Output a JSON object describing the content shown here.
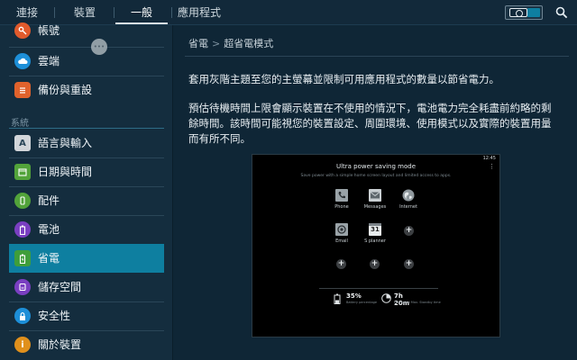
{
  "topbar": {
    "tabs": [
      {
        "label": "連接"
      },
      {
        "label": "裝置"
      },
      {
        "label": "一般"
      },
      {
        "label": "應用程式"
      }
    ],
    "active_tab": "一般",
    "toggle_state": "off"
  },
  "sidebar": {
    "items_top": [
      {
        "label": "帳號",
        "icon": "key-icon",
        "color": "#e05a2c"
      },
      {
        "label": "雲端",
        "icon": "cloud-icon",
        "color": "#1d8fd8"
      },
      {
        "label": "備份與重設",
        "icon": "backup-icon",
        "color": "#e0622c"
      }
    ],
    "section_label": "系統",
    "items": [
      {
        "label": "語言與輸入",
        "icon": "language-icon",
        "color": "#d2d6da"
      },
      {
        "label": "日期與時間",
        "icon": "calendar-icon",
        "color": "#52a33a"
      },
      {
        "label": "配件",
        "icon": "accessory-icon",
        "color": "#52a33a"
      },
      {
        "label": "電池",
        "icon": "battery-icon",
        "color": "#7a3fc1"
      },
      {
        "label": "省電",
        "icon": "power-saving-icon",
        "color": "#3f9e3a"
      },
      {
        "label": "儲存空間",
        "icon": "storage-icon",
        "color": "#7a3fc1"
      },
      {
        "label": "安全性",
        "icon": "lock-icon",
        "color": "#1d8fd8"
      },
      {
        "label": "關於裝置",
        "icon": "info-icon",
        "color": "#e0901c"
      }
    ],
    "active_item": "省電"
  },
  "main": {
    "breadcrumb": {
      "parent": "省電",
      "current": "超省電模式"
    },
    "para1": "套用灰階主題至您的主螢幕並限制可用應用程式的數量以節省電力。",
    "para2": "預估待機時間上限會顯示裝置在不使用的情況下，電池電力完全耗盡前約略的剩餘時間。該時間可能視您的裝置設定、周圍環境、使用模式以及實際的裝置用量而有所不同。",
    "preview": {
      "time": "12:45",
      "title": "Ultra power saving mode",
      "subtitle": "Save power with a simple home screen layout and limited access to apps.",
      "apps": [
        {
          "label": "Phone",
          "icon": "phone-icon"
        },
        {
          "label": "Messages",
          "icon": "messages-icon"
        },
        {
          "label": "Internet",
          "icon": "globe-icon"
        },
        {
          "label": "Email",
          "icon": "email-icon"
        },
        {
          "label": "S planner",
          "icon": "calendar-icon",
          "day": "31"
        }
      ],
      "battery": {
        "value": "35%",
        "caption": "Battery percentage"
      },
      "standby": {
        "value": "7h 20m",
        "caption": "Estimated Max. Standby time"
      }
    }
  }
}
